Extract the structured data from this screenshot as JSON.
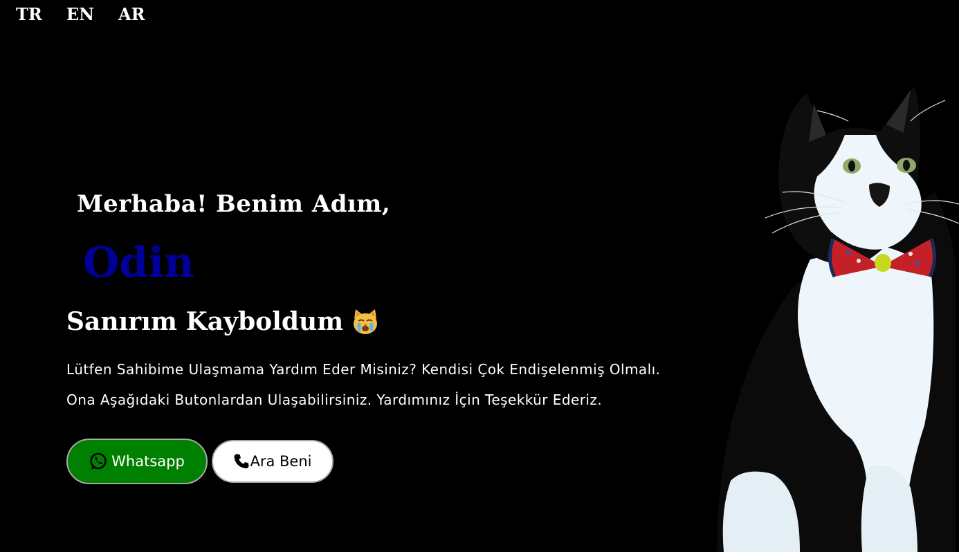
{
  "languages": {
    "tr": "TR",
    "en": "EN",
    "ar": "AR"
  },
  "hero": {
    "greeting": "Merhaba! Benim Adım,",
    "name": "Odin",
    "subtitle": "Sanırım Kayboldum",
    "subtitle_icon": "crying-cat-face-emoji",
    "message_line_1": "Lütfen Sahibime Ulaşmama Yardım Eder Misiniz? Kendisi Çok Endişelenmiş Olmalı.",
    "message_line_2": "Ona Aşağıdaki Butonlardan Ulaşabilirsiniz. Yardımınız İçin Teşekkür Ederiz."
  },
  "buttons": {
    "whatsapp_label": "Whatsapp",
    "whatsapp_icon": "whatsapp-icon",
    "call_label": "Ara Beni",
    "call_icon": "phone-icon"
  },
  "colors": {
    "background": "#000000",
    "name": "#000099",
    "whatsapp_button": "#008000",
    "call_button": "#ffffff"
  }
}
